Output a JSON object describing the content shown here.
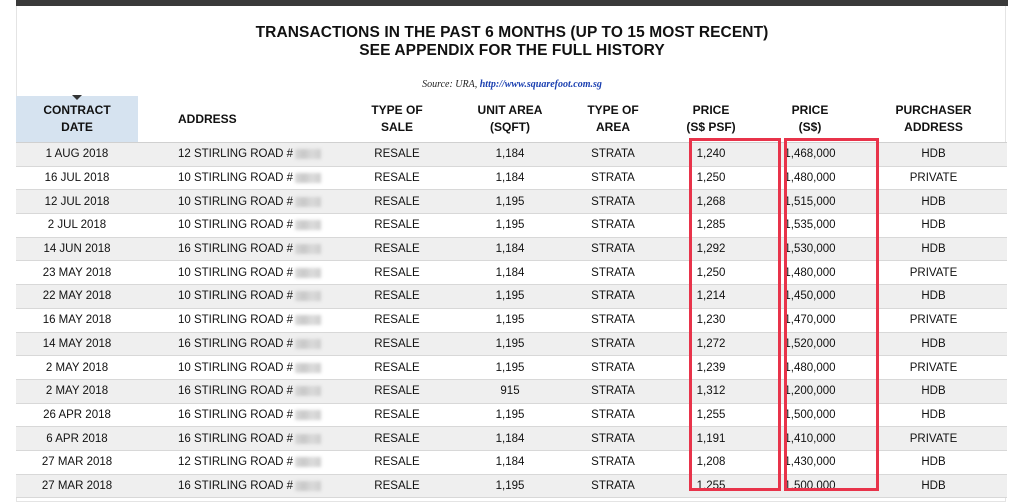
{
  "header": {
    "title_line1": "TRANSACTIONS IN THE PAST 6 MONTHS (UP TO 15 MOST RECENT)",
    "title_line2": "SEE APPENDIX FOR THE FULL HISTORY",
    "source_label": "Source: URA,",
    "source_link": "http://www.squarefoot.com.sg"
  },
  "table": {
    "columns": [
      {
        "key": "date",
        "line1": "CONTRACT",
        "line2": "DATE"
      },
      {
        "key": "address",
        "line1": "ADDRESS",
        "line2": ""
      },
      {
        "key": "sale",
        "line1": "TYPE OF",
        "line2": "SALE"
      },
      {
        "key": "area",
        "line1": "UNIT AREA",
        "line2": "(SQFT)"
      },
      {
        "key": "area_type",
        "line1": "TYPE OF",
        "line2": "AREA"
      },
      {
        "key": "psf",
        "line1": "PRICE",
        "line2": "(S$ PSF)"
      },
      {
        "key": "price",
        "line1": "PRICE",
        "line2": "(S$)"
      },
      {
        "key": "purchaser",
        "line1": "PURCHASER",
        "line2": "ADDRESS"
      }
    ],
    "rows": [
      {
        "date": "1 AUG 2018",
        "address": "12 STIRLING ROAD #",
        "sale": "RESALE",
        "area": "1,184",
        "area_type": "STRATA",
        "psf": "1,240",
        "price": "1,468,000",
        "purchaser": "HDB"
      },
      {
        "date": "16 JUL 2018",
        "address": "10 STIRLING ROAD #",
        "sale": "RESALE",
        "area": "1,184",
        "area_type": "STRATA",
        "psf": "1,250",
        "price": "1,480,000",
        "purchaser": "PRIVATE"
      },
      {
        "date": "12 JUL 2018",
        "address": "10 STIRLING ROAD #",
        "sale": "RESALE",
        "area": "1,195",
        "area_type": "STRATA",
        "psf": "1,268",
        "price": "1,515,000",
        "purchaser": "HDB"
      },
      {
        "date": "2 JUL 2018",
        "address": "10 STIRLING ROAD #",
        "sale": "RESALE",
        "area": "1,195",
        "area_type": "STRATA",
        "psf": "1,285",
        "price": "1,535,000",
        "purchaser": "HDB"
      },
      {
        "date": "14 JUN 2018",
        "address": "16 STIRLING ROAD #",
        "sale": "RESALE",
        "area": "1,184",
        "area_type": "STRATA",
        "psf": "1,292",
        "price": "1,530,000",
        "purchaser": "HDB"
      },
      {
        "date": "23 MAY 2018",
        "address": "10 STIRLING ROAD #",
        "sale": "RESALE",
        "area": "1,184",
        "area_type": "STRATA",
        "psf": "1,250",
        "price": "1,480,000",
        "purchaser": "PRIVATE"
      },
      {
        "date": "22 MAY 2018",
        "address": "10 STIRLING ROAD #",
        "sale": "RESALE",
        "area": "1,195",
        "area_type": "STRATA",
        "psf": "1,214",
        "price": "1,450,000",
        "purchaser": "HDB"
      },
      {
        "date": "16 MAY 2018",
        "address": "10 STIRLING ROAD #",
        "sale": "RESALE",
        "area": "1,195",
        "area_type": "STRATA",
        "psf": "1,230",
        "price": "1,470,000",
        "purchaser": "PRIVATE"
      },
      {
        "date": "14 MAY 2018",
        "address": "16 STIRLING ROAD #",
        "sale": "RESALE",
        "area": "1,195",
        "area_type": "STRATA",
        "psf": "1,272",
        "price": "1,520,000",
        "purchaser": "HDB"
      },
      {
        "date": "2 MAY 2018",
        "address": "10 STIRLING ROAD #",
        "sale": "RESALE",
        "area": "1,195",
        "area_type": "STRATA",
        "psf": "1,239",
        "price": "1,480,000",
        "purchaser": "PRIVATE"
      },
      {
        "date": "2 MAY 2018",
        "address": "16 STIRLING ROAD #",
        "sale": "RESALE",
        "area": "915",
        "area_type": "STRATA",
        "psf": "1,312",
        "price": "1,200,000",
        "purchaser": "HDB"
      },
      {
        "date": "26 APR 2018",
        "address": "16 STIRLING ROAD #",
        "sale": "RESALE",
        "area": "1,195",
        "area_type": "STRATA",
        "psf": "1,255",
        "price": "1,500,000",
        "purchaser": "HDB"
      },
      {
        "date": "6 APR 2018",
        "address": "16 STIRLING ROAD #",
        "sale": "RESALE",
        "area": "1,184",
        "area_type": "STRATA",
        "psf": "1,191",
        "price": "1,410,000",
        "purchaser": "PRIVATE"
      },
      {
        "date": "27 MAR 2018",
        "address": "12 STIRLING ROAD #",
        "sale": "RESALE",
        "area": "1,184",
        "area_type": "STRATA",
        "psf": "1,208",
        "price": "1,430,000",
        "purchaser": "HDB"
      },
      {
        "date": "27 MAR 2018",
        "address": "16 STIRLING ROAD #",
        "sale": "RESALE",
        "area": "1,195",
        "area_type": "STRATA",
        "psf": "1,255",
        "price": "1,500,000",
        "purchaser": "HDB"
      }
    ]
  },
  "colors": {
    "highlight": "#e8334a",
    "sorted_header": "#d6e3f0",
    "row_alt": "#efefef",
    "link": "#1a3fb0"
  }
}
